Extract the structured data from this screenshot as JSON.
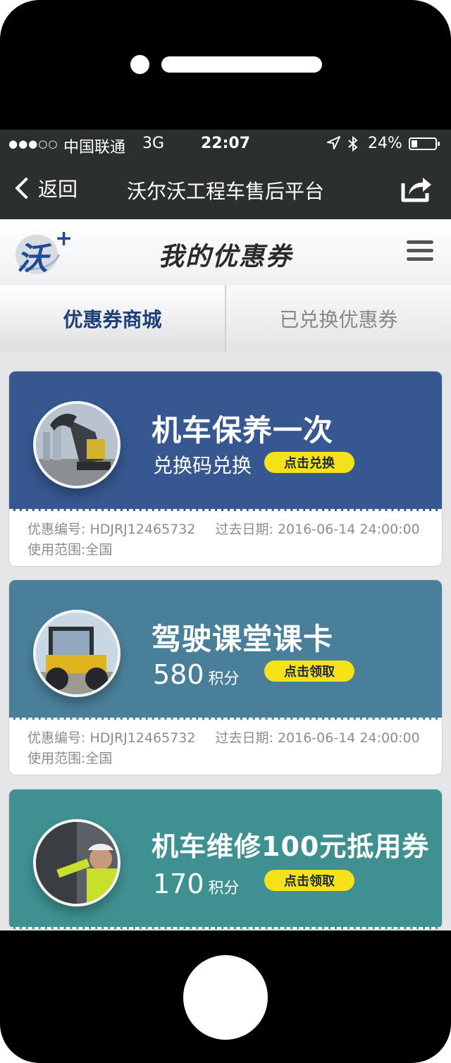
{
  "status_bar": {
    "signal": "●●●○○",
    "carrier": "中国联通",
    "network": "3G",
    "time": "22:07",
    "battery_percent": "24%",
    "battery_level": 0.24
  },
  "nav": {
    "back_label": "返回",
    "title": "沃尔沃工程车售后平台"
  },
  "brand": {
    "logo_text": "沃",
    "logo_plus": "+",
    "page_title": "我的优惠券"
  },
  "tabs": [
    {
      "label": "优惠券商城",
      "active": true
    },
    {
      "label": "已兑换优惠券",
      "active": false
    }
  ],
  "coupons": [
    {
      "title": "机车保养一次",
      "subtitle": "兑换码兑换",
      "button": "点击兑换",
      "code_label": "优惠编号:",
      "code": "HDJRJ12465732",
      "expiry_label": "过去日期:",
      "expiry": "2016-06-14  24:00:00",
      "scope_label": "使用范围:",
      "scope": "全国",
      "color": "#36578f",
      "image_icon": "excavator-icon"
    },
    {
      "title": "驾驶课堂课卡",
      "points": "580",
      "points_unit": "积分",
      "button": "点击领取",
      "code_label": "优惠编号:",
      "code": "HDJRJ12465732",
      "expiry_label": "过去日期:",
      "expiry": "2016-06-14  24:00:00",
      "scope_label": "使用范围:",
      "scope": "全国",
      "color": "#4a7f9a",
      "image_icon": "wheel-loader-icon"
    },
    {
      "title": "机车维修100元抵用券",
      "points": "170",
      "points_unit": "积分",
      "button": "点击领取",
      "color": "#3f9090",
      "image_icon": "mechanic-icon"
    }
  ]
}
